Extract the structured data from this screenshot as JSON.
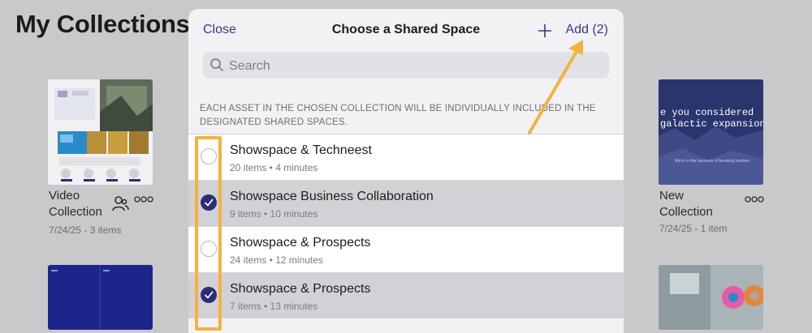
{
  "page": {
    "title": "My Collections"
  },
  "collections": [
    {
      "name_line1": "Video",
      "name_line2": "Collection",
      "meta": "7/24/25 - 3 items",
      "shared": true
    },
    {
      "name_line1": "New",
      "name_line2": "Collection",
      "meta": "7/24/25 - 1 item",
      "shared": false
    }
  ],
  "thumb_text": {
    "galactic_line1": "e you considered",
    "galactic_line2": "galactic expansion",
    "galactic_small": "We're in the business of breaking barriers"
  },
  "modal": {
    "close_label": "Close",
    "title": "Choose a Shared Space",
    "add_label": "Add (2)",
    "search_placeholder": "Search",
    "notice_line1": "EACH ASSET IN THE CHOSEN COLLECTION WILL BE INDIVIDUALLY INCLUDED IN THE",
    "notice_line2": "DESIGNATED SHARED SPACES.",
    "spaces": [
      {
        "name": "Showspace & Techneest",
        "meta": "20 items • 4 minutes",
        "selected": false
      },
      {
        "name": "Showspace Business Collaboration",
        "meta": "9 items • 10 minutes",
        "selected": true
      },
      {
        "name": "Showspace & Prospects",
        "meta": "24 items • 12 minutes",
        "selected": false
      },
      {
        "name": "Showspace & Prospects",
        "meta": "7 items • 13 minutes",
        "selected": true
      }
    ]
  },
  "colors": {
    "accent": "#2e3a8c",
    "checked": "#2b2d7a",
    "annotation": "#f3b33f"
  },
  "icons": [
    "plus-icon",
    "search-icon",
    "checkmark-icon",
    "more-icon",
    "shared-users-icon"
  ]
}
